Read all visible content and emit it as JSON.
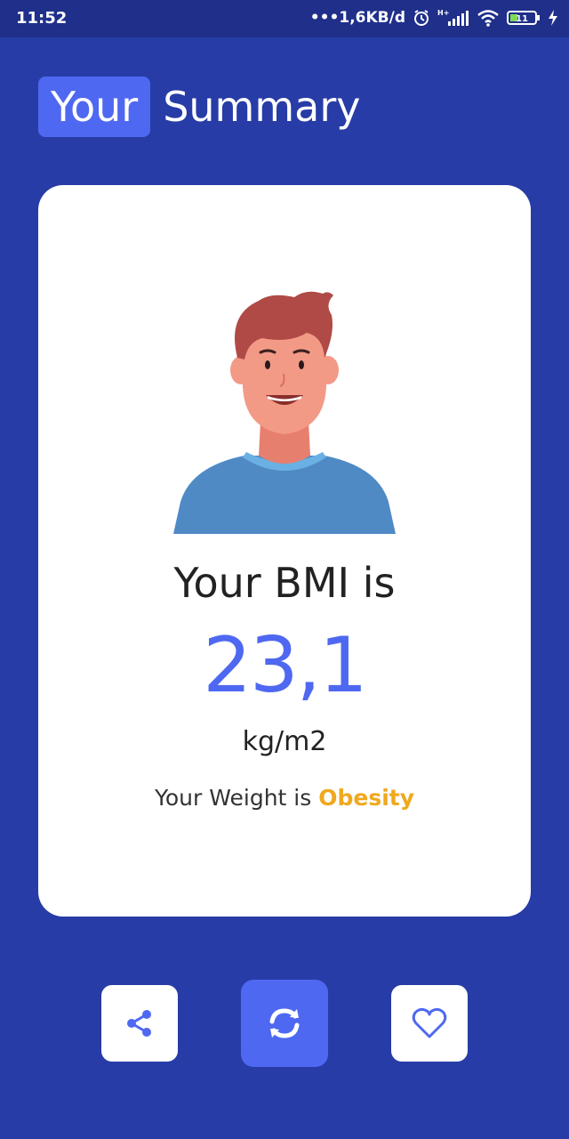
{
  "status_bar": {
    "time": "11:52",
    "network_speed": "•••1,6KB/d",
    "network_type": "H+",
    "battery_level": "11"
  },
  "header": {
    "title_highlight": "Your",
    "title_rest": "Summary"
  },
  "result": {
    "bmi_label": "Your BMI is",
    "bmi_value": "23,1",
    "bmi_unit": "kg/m2",
    "weight_prefix": "Your Weight is",
    "weight_status": "Obesity"
  },
  "actions": {
    "share_icon": "share-icon",
    "refresh_icon": "refresh-icon",
    "favorite_icon": "heart-icon"
  },
  "colors": {
    "background": "#273ca6",
    "accent": "#4f68f1",
    "status": "#f0a81e",
    "card": "#ffffff"
  }
}
